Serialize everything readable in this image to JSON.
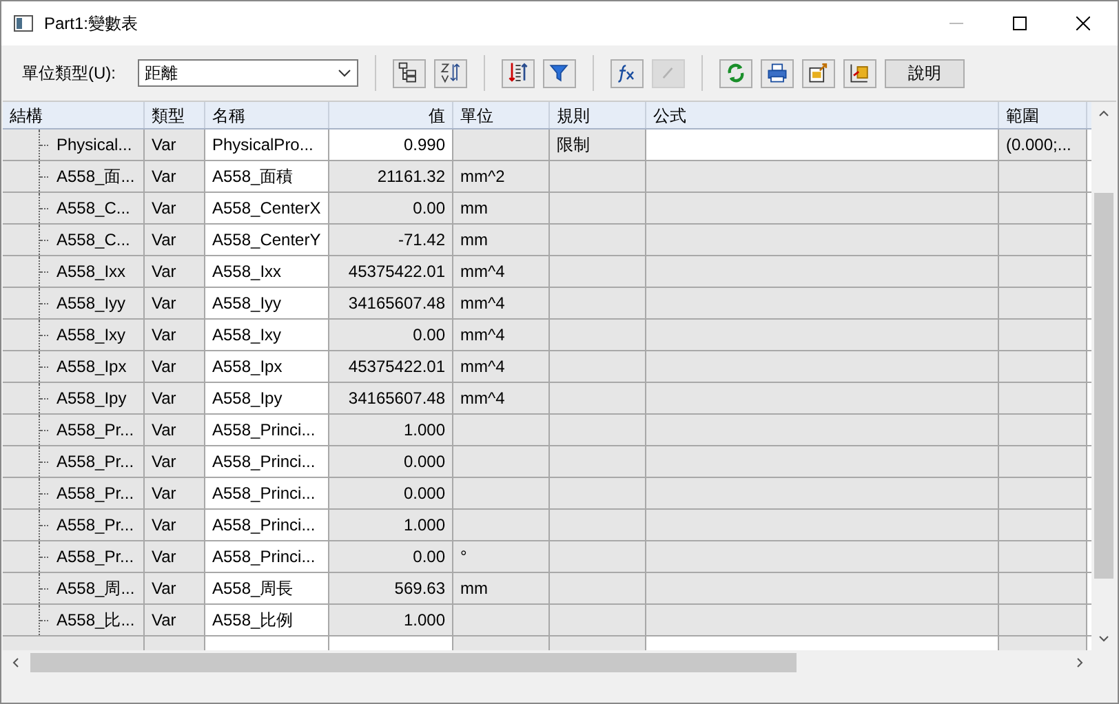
{
  "window": {
    "title": "Part1:變數表"
  },
  "toolbar": {
    "unit_type_label": "單位類型(U):",
    "unit_type_value": "距離",
    "buttons": [
      {
        "disabled": false
      },
      {
        "disabled": false
      },
      {
        "disabled": false
      },
      {
        "disabled": false
      },
      {
        "disabled": false
      },
      {
        "disabled": true
      },
      {
        "disabled": false
      },
      {
        "disabled": false
      },
      {
        "disabled": false
      },
      {
        "disabled": false
      }
    ],
    "help_button": "說明"
  },
  "table": {
    "columns": [
      "結構",
      "類型",
      "名稱",
      "值",
      "單位",
      "規則",
      "公式",
      "範圍"
    ],
    "rows": [
      {
        "structure": "Physical...",
        "type": "Var",
        "name": "PhysicalPro...",
        "value": "0.990",
        "unit": "",
        "rule": "限制",
        "range": "(0.000;...",
        "editable": true
      },
      {
        "structure": "A558_面...",
        "type": "Var",
        "name": "A558_面積",
        "value": "21161.32",
        "unit": "mm^2",
        "editable": false
      },
      {
        "structure": "A558_C...",
        "type": "Var",
        "name": "A558_CenterX",
        "value": "0.00",
        "unit": "mm",
        "editable": false
      },
      {
        "structure": "A558_C...",
        "type": "Var",
        "name": "A558_CenterY",
        "value": "-71.42",
        "unit": "mm",
        "editable": false
      },
      {
        "structure": "A558_Ixx",
        "type": "Var",
        "name": "A558_Ixx",
        "value": "45375422.01",
        "unit": "mm^4",
        "editable": false
      },
      {
        "structure": "A558_Iyy",
        "type": "Var",
        "name": "A558_Iyy",
        "value": "34165607.48",
        "unit": "mm^4",
        "editable": false
      },
      {
        "structure": "A558_Ixy",
        "type": "Var",
        "name": "A558_Ixy",
        "value": "0.00",
        "unit": "mm^4",
        "editable": false
      },
      {
        "structure": "A558_Ipx",
        "type": "Var",
        "name": "A558_Ipx",
        "value": "45375422.01",
        "unit": "mm^4",
        "editable": false
      },
      {
        "structure": "A558_Ipy",
        "type": "Var",
        "name": "A558_Ipy",
        "value": "34165607.48",
        "unit": "mm^4",
        "editable": false
      },
      {
        "structure": "A558_Pr...",
        "type": "Var",
        "name": "A558_Princi...",
        "value": "1.000",
        "unit": "",
        "editable": false
      },
      {
        "structure": "A558_Pr...",
        "type": "Var",
        "name": "A558_Princi...",
        "value": "0.000",
        "unit": "",
        "editable": false
      },
      {
        "structure": "A558_Pr...",
        "type": "Var",
        "name": "A558_Princi...",
        "value": "0.000",
        "unit": "",
        "editable": false
      },
      {
        "structure": "A558_Pr...",
        "type": "Var",
        "name": "A558_Princi...",
        "value": "1.000",
        "unit": "",
        "editable": false
      },
      {
        "structure": "A558_Pr...",
        "type": "Var",
        "name": "A558_Princi...",
        "value": "0.00",
        "unit": "°",
        "editable": false
      },
      {
        "structure": "A558_周...",
        "type": "Var",
        "name": "A558_周長",
        "value": "569.63",
        "unit": "mm",
        "editable": false
      },
      {
        "structure": "A558_比...",
        "type": "Var",
        "name": "A558_比例",
        "value": "1.000",
        "unit": "",
        "editable": false
      }
    ]
  }
}
